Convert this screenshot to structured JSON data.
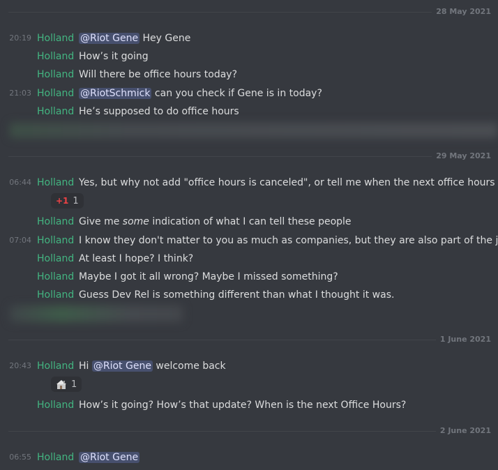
{
  "channel": {
    "divider1": "28 May 2021",
    "divider2": "29 May 2021",
    "divider3": "1 June 2021",
    "divider4": "2 June 2021"
  },
  "messages": [
    {
      "time": "20:19",
      "author": "Holland",
      "mention": "@Riot Gene",
      "text": " Hey Gene"
    },
    {
      "time": "",
      "author": "Holland",
      "text": "How’s it going"
    },
    {
      "time": "",
      "author": "Holland",
      "text": "Will there be office hours today?"
    },
    {
      "time": "21:03",
      "author": "Holland",
      "mention": "@RiotSchmick",
      "text": " can you check if Gene is in today?"
    },
    {
      "time": "",
      "author": "Holland",
      "text": "He’s supposed to do office hours"
    },
    {
      "time": "06:44",
      "author": "Holland",
      "text": "Yes, but why not add \"office hours is canceled\", or tell me when the next office hours is?"
    },
    {
      "time": "",
      "author": "Holland",
      "text_pre": "Give me ",
      "text_em": "some",
      "text_post": " indication of what I can tell these people"
    },
    {
      "time": "07:04",
      "author": "Holland",
      "text": "I know they don't matter to you as much as companies, but they are also part of the job"
    },
    {
      "time": "",
      "author": "Holland",
      "text": "At least I hope? I think?"
    },
    {
      "time": "",
      "author": "Holland",
      "text": "Maybe I got it all wrong? Maybe I missed something?"
    },
    {
      "time": "",
      "author": "Holland",
      "text": "Guess Dev Rel is something different than what I thought it was."
    },
    {
      "time": "20:43",
      "author": "Holland",
      "text_pre": "Hi ",
      "mention": "@Riot Gene",
      "text_post": " welcome back"
    },
    {
      "time": "",
      "author": "Holland",
      "text": "How’s it going? How’s that update? When is the next Office Hours?"
    },
    {
      "time": "06:55",
      "author": "Holland",
      "mention": "@Riot Gene"
    }
  ],
  "reactions": [
    {
      "emoji": "+1",
      "count": "1"
    },
    {
      "emoji": "house-icon",
      "count": "1"
    }
  ]
}
